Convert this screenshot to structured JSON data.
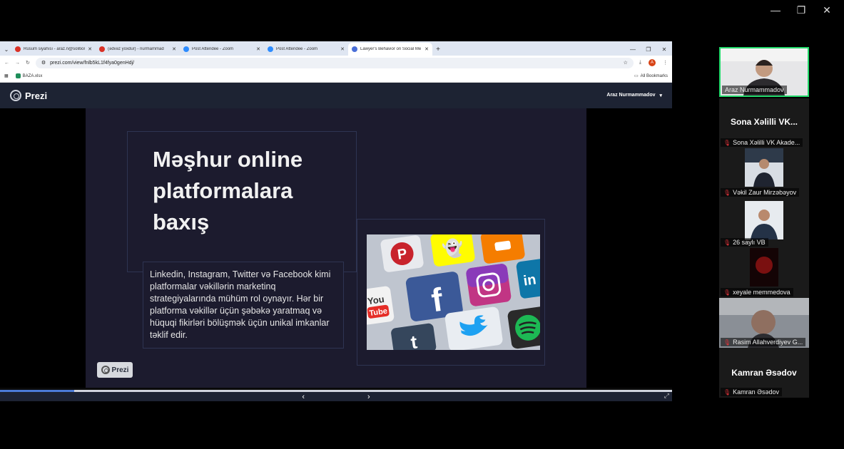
{
  "window_controls": {
    "minimize": "—",
    "restore": "❐",
    "close": "✕"
  },
  "browser": {
    "tabs": [
      {
        "title": "Rüsum siyahısı - araz.n@solition",
        "icon_color": "#d93025",
        "active": false
      },
      {
        "title": "(ədvəz yoxdur) - nurmammad",
        "icon_color": "#d93025",
        "active": false
      },
      {
        "title": "Post Attendee - Zoom",
        "icon_color": "#2d8cff",
        "active": false
      },
      {
        "title": "Post Attendee - Zoom",
        "icon_color": "#2d8cff",
        "active": false
      },
      {
        "title": "Lawyer's Behavior on Social Me",
        "icon_color": "#4a6fd8",
        "active": true
      }
    ],
    "url": "prezi.com/view/fnlb5kL1f4fya0genHdj/",
    "avatar_letter": "A",
    "bookmark": "BAZA.xlsx",
    "all_bookmarks": "All Bookmarks"
  },
  "prezi": {
    "logo": "Prezi",
    "user": "Araz Nurmammadov",
    "slide_title": "Məşhur online platformalara baxış",
    "slide_body": "Linkedin, Instagram, Twitter və Facebook kimi platformalar vəkillərin marketinq strategiyalarında mühüm rol oynayır. Hər bir platforma vəkillər üçün şəbəkə yaratmaq və hüquqi fikirləri bölüşmək üçün unikal imkanlar təklif edir.",
    "badge": "Prezi",
    "progress": 0.11,
    "prev": "‹",
    "next": "›"
  },
  "participants": [
    {
      "name": "Araz Nurmammadov",
      "muted": false,
      "video": true,
      "active": true
    },
    {
      "name": "Sona Xəlilli VK Akade...",
      "big_name": "Sona Xəlilli VK...",
      "muted": true,
      "video": false
    },
    {
      "name": "Vəkil Zaur Mirzəbəyov",
      "muted": true,
      "video": true
    },
    {
      "name": "26 saylı VB",
      "muted": true,
      "video": true
    },
    {
      "name": "xeyale memmedova",
      "muted": true,
      "video": true
    },
    {
      "name": "Rasim Allahverdiyev G...",
      "muted": true,
      "video": true
    },
    {
      "name": "Kamran Əsədov",
      "big_name": "Kamran Əsədov",
      "muted": true,
      "video": false
    }
  ],
  "colors": {
    "accent": "#23d96b",
    "slide_bg": "#1c1b2e",
    "prezi_header": "#1d2333"
  }
}
